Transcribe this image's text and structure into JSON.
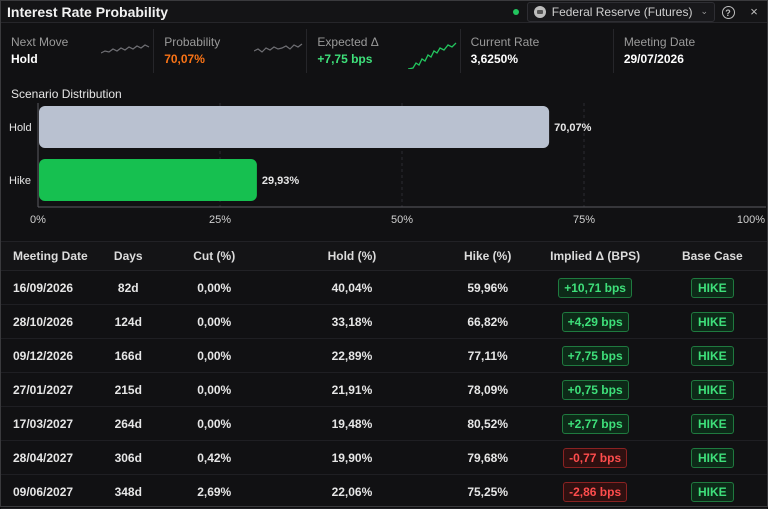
{
  "header": {
    "title": "Interest Rate Probability",
    "source": "Federal Reserve (Futures)",
    "help": "?",
    "close": "×"
  },
  "metrics": [
    {
      "label": "Next Move",
      "value": "Hold",
      "color": "#ffffff"
    },
    {
      "label": "Probability",
      "value": "70,07%",
      "color": "#f97316"
    },
    {
      "label": "Expected Δ",
      "value": "+7,75 bps",
      "color": "#3ee07a"
    },
    {
      "label": "Current Rate",
      "value": "3,6250%",
      "color": "#ffffff"
    },
    {
      "label": "Meeting Date",
      "value": "29/07/2026",
      "color": "#ffffff"
    }
  ],
  "scenario": {
    "title": "Scenario Distribution"
  },
  "chart_data": {
    "type": "bar",
    "orientation": "horizontal",
    "categories": [
      "Hold",
      "Hike"
    ],
    "values": [
      70.07,
      29.93
    ],
    "labels": [
      "70,07%",
      "29,93%"
    ],
    "colors": [
      "#b9c1d0",
      "#16c050"
    ],
    "xlim": [
      0,
      100
    ],
    "xticks": [
      "0%",
      "25%",
      "50%",
      "75%",
      "100%"
    ],
    "grid": "vertical dashed"
  },
  "table": {
    "headers": [
      "Meeting Date",
      "Days",
      "Cut (%)",
      "Hold (%)",
      "Hike (%)",
      "Implied Δ (BPS)",
      "Base Case"
    ],
    "rows": [
      {
        "date": "16/09/2026",
        "days": "82d",
        "cut": "0,00%",
        "hold": "40,04%",
        "hike": "59,96%",
        "implied": "+10,71 bps",
        "sign": "pos",
        "base": "HIKE"
      },
      {
        "date": "28/10/2026",
        "days": "124d",
        "cut": "0,00%",
        "hold": "33,18%",
        "hike": "66,82%",
        "implied": "+4,29 bps",
        "sign": "pos",
        "base": "HIKE"
      },
      {
        "date": "09/12/2026",
        "days": "166d",
        "cut": "0,00%",
        "hold": "22,89%",
        "hike": "77,11%",
        "implied": "+7,75 bps",
        "sign": "pos",
        "base": "HIKE"
      },
      {
        "date": "27/01/2027",
        "days": "215d",
        "cut": "0,00%",
        "hold": "21,91%",
        "hike": "78,09%",
        "implied": "+0,75 bps",
        "sign": "pos",
        "base": "HIKE"
      },
      {
        "date": "17/03/2027",
        "days": "264d",
        "cut": "0,00%",
        "hold": "19,48%",
        "hike": "80,52%",
        "implied": "+2,77 bps",
        "sign": "pos",
        "base": "HIKE"
      },
      {
        "date": "28/04/2027",
        "days": "306d",
        "cut": "0,42%",
        "hold": "19,90%",
        "hike": "79,68%",
        "implied": "-0,77 bps",
        "sign": "neg",
        "base": "HIKE"
      },
      {
        "date": "09/06/2027",
        "days": "348d",
        "cut": "2,69%",
        "hold": "22,06%",
        "hike": "75,25%",
        "implied": "-2,86 bps",
        "sign": "neg",
        "base": "HIKE"
      }
    ]
  }
}
